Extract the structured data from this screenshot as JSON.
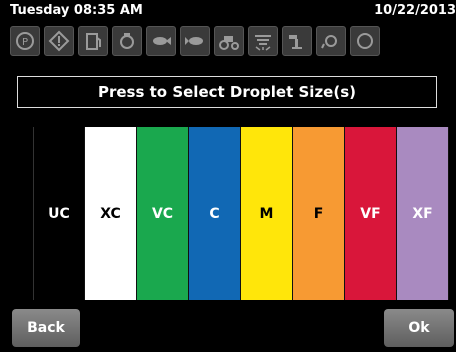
{
  "status": {
    "day_time": "Tuesday 08:35 AM",
    "date": "10/22/2013"
  },
  "icons": [
    "parking-brake-icon",
    "warning-icon",
    "fuel-icon",
    "engine-icon",
    "fish-icon",
    "fish-icon-2",
    "tractor-icon",
    "sprayer-icon",
    "nozzle-icon",
    "camera-icon",
    "circle-icon"
  ],
  "prompt": "Press to Select Droplet Size(s)",
  "droplet_sizes": [
    {
      "label": "UC",
      "bg": "#000000",
      "fg": "#ffffff"
    },
    {
      "label": "XC",
      "bg": "#ffffff",
      "fg": "#000000"
    },
    {
      "label": "VC",
      "bg": "#1aa84e",
      "fg": "#ffffff"
    },
    {
      "label": "C",
      "bg": "#1168b4",
      "fg": "#ffffff"
    },
    {
      "label": "M",
      "bg": "#ffe60a",
      "fg": "#000000"
    },
    {
      "label": "F",
      "bg": "#f79a33",
      "fg": "#000000"
    },
    {
      "label": "VF",
      "bg": "#d9163a",
      "fg": "#ffffff"
    },
    {
      "label": "XF",
      "bg": "#a98ac0",
      "fg": "#ffffff"
    }
  ],
  "buttons": {
    "back": "Back",
    "ok": "Ok"
  }
}
